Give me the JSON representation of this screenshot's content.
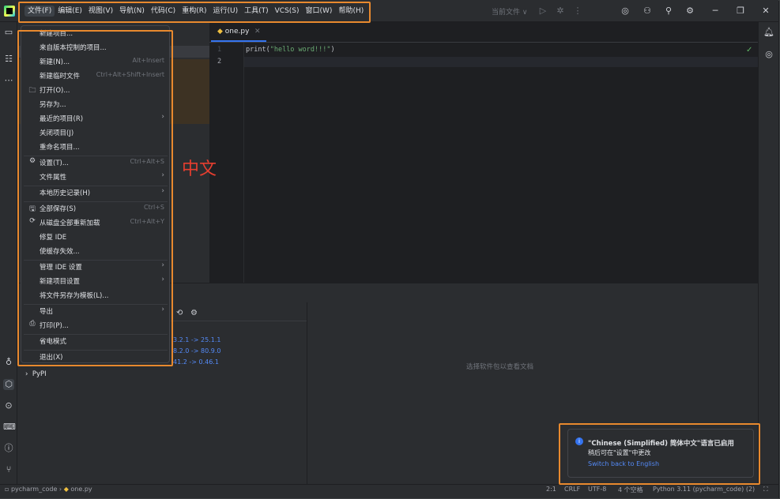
{
  "menubar": {
    "items": [
      "文件(F)",
      "编辑(E)",
      "视图(V)",
      "导航(N)",
      "代码(C)",
      "重构(R)",
      "运行(U)",
      "工具(T)",
      "VCS(S)",
      "窗口(W)",
      "帮助(H)"
    ]
  },
  "toolbar": {
    "run_config": "当前文件 ∨"
  },
  "editor": {
    "tab_label": "one.py",
    "line_numbers": [
      "1",
      "2"
    ],
    "code_fn": "print(",
    "code_str": "\"hello word!!!\"",
    "code_end": ")"
  },
  "file_menu": {
    "items": [
      {
        "label": "新建项目...",
        "shortcut": "",
        "arrow": false,
        "icon": ""
      },
      {
        "label": "来自版本控制的项目...",
        "shortcut": "",
        "arrow": false,
        "icon": ""
      },
      {
        "label": "新建(N)...",
        "shortcut": "Alt+Insert",
        "arrow": false,
        "icon": ""
      },
      {
        "label": "新建临时文件",
        "shortcut": "Ctrl+Alt+Shift+Insert",
        "arrow": false,
        "icon": ""
      },
      {
        "label": "打开(O)...",
        "shortcut": "",
        "arrow": false,
        "icon": "folder-icon"
      },
      {
        "label": "另存为...",
        "shortcut": "",
        "arrow": false,
        "icon": ""
      },
      {
        "label": "最近的项目(R)",
        "shortcut": "",
        "arrow": true,
        "icon": ""
      },
      {
        "label": "关闭项目(J)",
        "shortcut": "",
        "arrow": false,
        "icon": ""
      },
      {
        "label": "重命名项目...",
        "shortcut": "",
        "arrow": false,
        "icon": ""
      },
      {
        "label": "设置(T)...",
        "shortcut": "Ctrl+Alt+S",
        "arrow": false,
        "icon": "gear-icon"
      },
      {
        "label": "文件属性",
        "shortcut": "",
        "arrow": true,
        "icon": ""
      },
      {
        "label": "本地历史记录(H)",
        "shortcut": "",
        "arrow": true,
        "icon": ""
      },
      {
        "label": "全部保存(S)",
        "shortcut": "Ctrl+S",
        "arrow": false,
        "icon": "save-icon"
      },
      {
        "label": "从磁盘全部重新加载",
        "shortcut": "Ctrl+Alt+Y",
        "arrow": false,
        "icon": "reload-icon"
      },
      {
        "label": "修复 IDE",
        "shortcut": "",
        "arrow": false,
        "icon": ""
      },
      {
        "label": "使缓存失效...",
        "shortcut": "",
        "arrow": false,
        "icon": ""
      },
      {
        "label": "管理 IDE 设置",
        "shortcut": "",
        "arrow": true,
        "icon": ""
      },
      {
        "label": "新建项目设置",
        "shortcut": "",
        "arrow": true,
        "icon": ""
      },
      {
        "label": "将文件另存为模板(L)...",
        "shortcut": "",
        "arrow": false,
        "icon": ""
      },
      {
        "label": "导出",
        "shortcut": "",
        "arrow": true,
        "icon": ""
      },
      {
        "label": "打印(P)...",
        "shortcut": "",
        "arrow": false,
        "icon": "print-icon"
      },
      {
        "label": "省电模式",
        "shortcut": "",
        "arrow": false,
        "icon": ""
      },
      {
        "label": "退出(X)",
        "shortcut": "",
        "arrow": false,
        "icon": ""
      }
    ]
  },
  "packages": {
    "versions": [
      "3.2.1 -> 25.1.1",
      "8.2.0 -> 80.9.0",
      "41.2 -> 0.46.1"
    ],
    "placeholder": "选择软件包以查看文档",
    "pypi": "PyPI"
  },
  "annotation": {
    "label": "中文"
  },
  "notification": {
    "title": "\"Chinese (Simplified) 简体中文\"语言已启用",
    "body": "稍后可在\"设置\"中更改",
    "link": "Switch back to English"
  },
  "statusbar": {
    "project": "pycharm_code",
    "file": "one.py",
    "position": "2:1",
    "line_sep": "CRLF",
    "encoding": "UTF-8",
    "indent": "4 个空格",
    "interpreter": "Python 3.11 (pycharm_code) (2)"
  },
  "colors": {
    "accent": "#3574f0",
    "annotation_border": "#e8892e",
    "annotation_text": "#e53e2f"
  }
}
